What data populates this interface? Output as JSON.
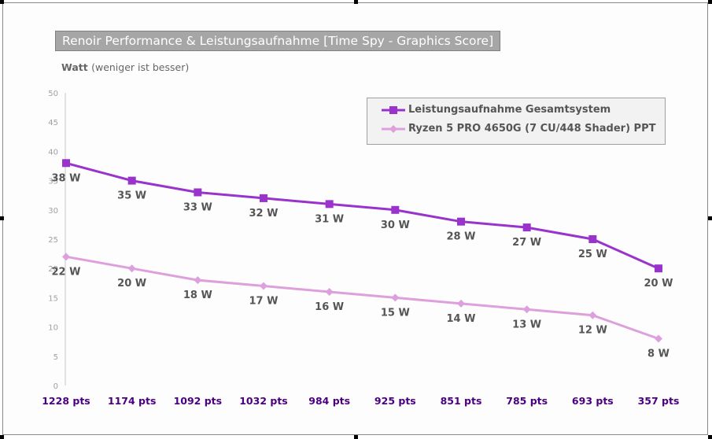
{
  "chart_data": {
    "type": "line",
    "title": "Renoir Performance & Leistungsaufnahme [Time Spy - Graphics Score]",
    "ylabel": "Watt",
    "ylabel_note": "(weniger ist besser)",
    "categories": [
      "1228 pts",
      "1174 pts",
      "1092 pts",
      "1032 pts",
      "984 pts",
      "925 pts",
      "851 pts",
      "785 pts",
      "693 pts",
      "357 pts"
    ],
    "ylim": [
      0,
      50
    ],
    "yticks": [
      0,
      5,
      10,
      15,
      20,
      25,
      30,
      35,
      40,
      45,
      50
    ],
    "grid": false,
    "legend_position": "top-right",
    "series": [
      {
        "name": "Leistungsaufnahme Gesamtsystem",
        "color": "#9933CC",
        "marker": "square",
        "values": [
          38,
          35,
          33,
          32,
          31,
          30,
          28,
          27,
          25,
          20
        ],
        "labels": [
          "38 W",
          "35 W",
          "33 W",
          "32 W",
          "31 W",
          "30 W",
          "28 W",
          "27 W",
          "25 W",
          "20 W"
        ]
      },
      {
        "name": "Ryzen 5 PRO 4650G (7 CU/448 Shader) PPT",
        "color": "#DDA0DD",
        "marker": "diamond",
        "values": [
          22,
          20,
          18,
          17,
          16,
          15,
          14,
          13,
          12,
          8
        ],
        "labels": [
          "22 W",
          "20 W",
          "18 W",
          "17 W",
          "16 W",
          "15 W",
          "14 W",
          "13 W",
          "12 W",
          "8 W"
        ]
      }
    ]
  }
}
